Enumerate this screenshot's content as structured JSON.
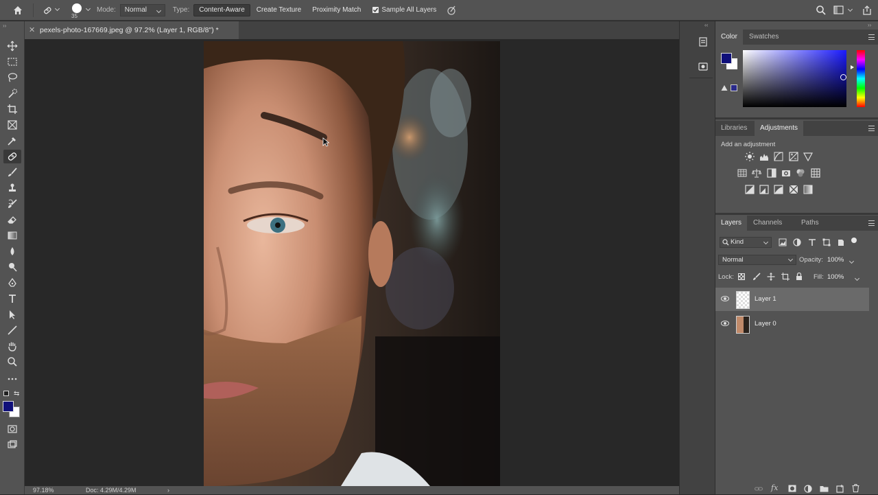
{
  "options_bar": {
    "brush_size": "35",
    "mode_label": "Mode:",
    "mode_value": "Normal",
    "type_label": "Type:",
    "type_buttons": [
      "Content-Aware",
      "Create Texture",
      "Proximity Match"
    ],
    "sample_all_layers_label": "Sample All Layers",
    "sample_all_layers_checked": true
  },
  "document": {
    "tab_title": "pexels-photo-167669.jpeg @ 97.2% (Layer 1, RGB/8\") *"
  },
  "status_bar": {
    "zoom": "97.18%",
    "doc_size": "Doc: 4.29M/4.29M",
    "arrow": "›"
  },
  "color_panel": {
    "tabs": [
      "Color",
      "Swatches"
    ],
    "foreground_color": "#10107a",
    "background_color": "#ffffff"
  },
  "adjustments_panel": {
    "tabs": [
      "Libraries",
      "Adjustments"
    ],
    "add_label": "Add an adjustment"
  },
  "layers_panel": {
    "tabs": [
      "Layers",
      "Channels",
      "Paths"
    ],
    "filter_kind": "Kind",
    "blend_mode": "Normal",
    "opacity_label": "Opacity:",
    "opacity_value": "100%",
    "lock_label": "Lock:",
    "fill_label": "Fill:",
    "fill_value": "100%",
    "layers": [
      {
        "name": "Layer 1",
        "selected": true,
        "visible": true
      },
      {
        "name": "Layer 0",
        "selected": false,
        "visible": true
      }
    ]
  },
  "colors": {
    "app_dark": "#282828",
    "panel": "#535353",
    "accent_foreground": "#10107a"
  }
}
